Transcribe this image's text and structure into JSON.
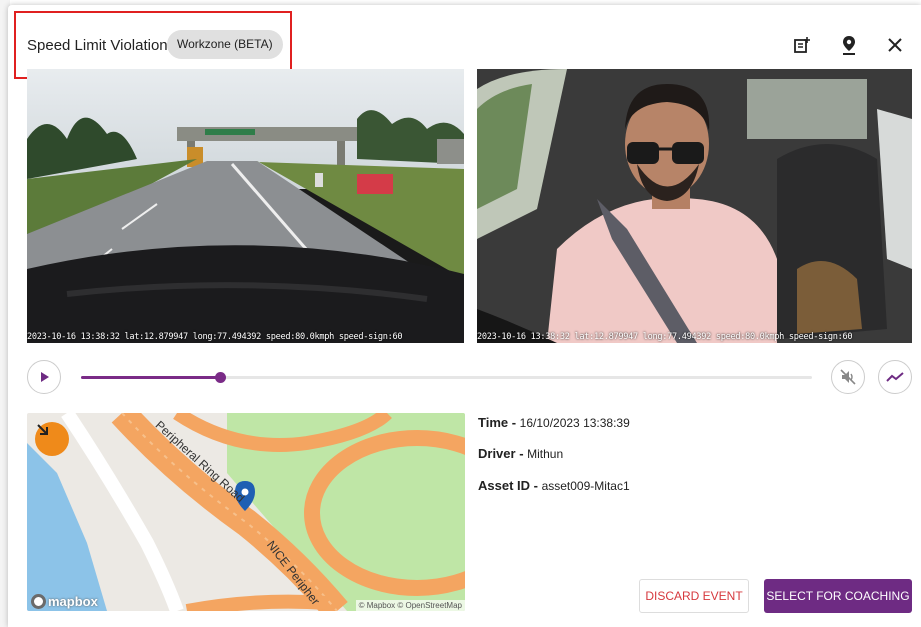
{
  "modal": {
    "title": "Speed Limit Violation",
    "tag": "Workzone (BETA)"
  },
  "header_icons": [
    "add-note-icon",
    "location-pin-icon",
    "close-icon"
  ],
  "videos": {
    "road_overlay": "2023-10-16 13:38:32 lat:12.879947 long:77.494392 speed:80.0kmph speed-sign:60",
    "cabin_overlay": "2023-10-16 13:38:32 lat:12.879947 long:77.494392 speed:80.0kmph speed-sign:60"
  },
  "player": {
    "progress_fraction": 0.19,
    "icons": [
      "play-icon",
      "mute-icon",
      "trend-icon"
    ]
  },
  "map": {
    "road_label_1": "Peripheral Ring Road",
    "road_label_2": "NICE Peripher",
    "brand": "mapbox",
    "attribution": "© Mapbox © OpenStreetMap"
  },
  "details": {
    "time_label": "Time - ",
    "time_value": "16/10/2023 13:38:39",
    "driver_label": "Driver - ",
    "driver_value": "Mithun",
    "asset_label": "Asset ID - ",
    "asset_value": "asset009-Mitac1"
  },
  "actions": {
    "discard": "DISCARD EVENT",
    "coach": "SELECT FOR COACHING"
  },
  "colors": {
    "accent": "#6e2b83",
    "danger": "#d6383d",
    "highlight_box": "#e02020"
  }
}
